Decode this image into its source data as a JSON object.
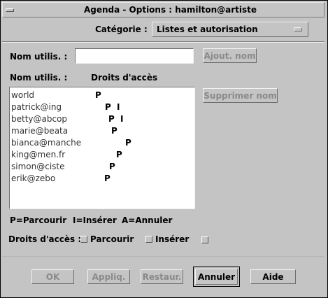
{
  "window": {
    "title": "Agenda - Options : hamilton@artiste"
  },
  "category": {
    "label": "Catégorie :",
    "value": "Listes et autorisation"
  },
  "user": {
    "label": "Nom utilis. :",
    "value": "",
    "add_button": "Ajout. nom"
  },
  "list": {
    "header_name": "Nom utilis. :",
    "header_rights": "Droits d'accès",
    "delete_button": "Supprimer nom",
    "items": [
      {
        "name": "world",
        "rights": "P"
      },
      {
        "name": "patrick@ing",
        "rights": "P I"
      },
      {
        "name": "betty@abcop",
        "rights": "P I"
      },
      {
        "name": "marie@beata",
        "rights": "P"
      },
      {
        "name": "bianca@manche",
        "rights": "P"
      },
      {
        "name": "king@men.fr",
        "rights": "P"
      },
      {
        "name": "simon@ciste",
        "rights": "P"
      },
      {
        "name": "erik@zebo",
        "rights": "P"
      }
    ]
  },
  "legend": {
    "p": "P=Parcourir",
    "i": "I=Insérer",
    "a": "A=Annuler"
  },
  "access": {
    "label": "Droits d'accès :",
    "parcourir": "Parcourir",
    "inserer": "Insérer"
  },
  "buttons": {
    "ok": "OK",
    "apply": "Appliq.",
    "reset": "Restaur.",
    "cancel": "Annuler",
    "help": "Aide"
  }
}
